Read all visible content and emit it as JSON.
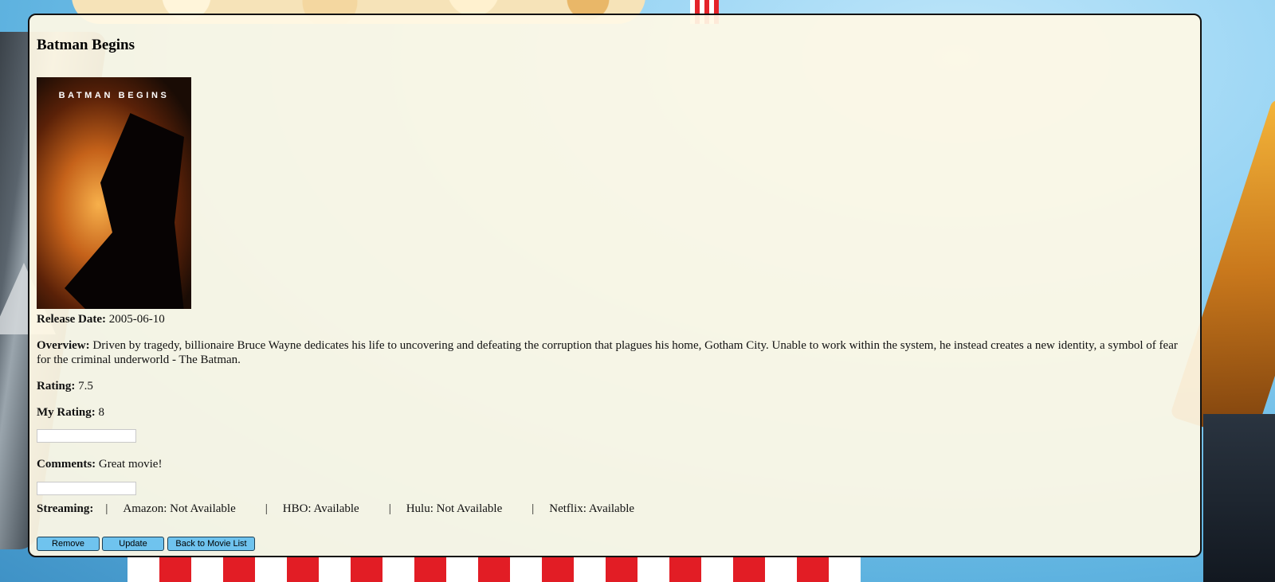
{
  "movie": {
    "title": "Batman Begins",
    "poster_text": "BATMAN BEGINS",
    "release_label": "Release Date:",
    "release_date": "2005-06-10",
    "overview_label": "Overview:",
    "overview": "Driven by tragedy, billionaire Bruce Wayne dedicates his life to uncovering and defeating the corruption that plagues his home, Gotham City. Unable to work within the system, he instead creates a new identity, a symbol of fear for the criminal underworld - The Batman.",
    "rating_label": "Rating:",
    "rating": "7.5",
    "my_rating_label": "My Rating:",
    "my_rating": "8",
    "my_rating_input": "",
    "comments_label": "Comments:",
    "comments": "Great movie!",
    "comments_input": ""
  },
  "streaming": {
    "label": "Streaming:",
    "separator": "|",
    "services": [
      {
        "text": "Amazon: Not Available"
      },
      {
        "text": "HBO: Available"
      },
      {
        "text": "Hulu: Not Available"
      },
      {
        "text": "Netflix: Available"
      }
    ]
  },
  "buttons": {
    "remove": "Remove",
    "update": "Update",
    "back": "Back to Movie List"
  },
  "colors": {
    "panel_bg": "#fff9e5",
    "button_bg": "#6fc3ee",
    "border": "#111111"
  }
}
